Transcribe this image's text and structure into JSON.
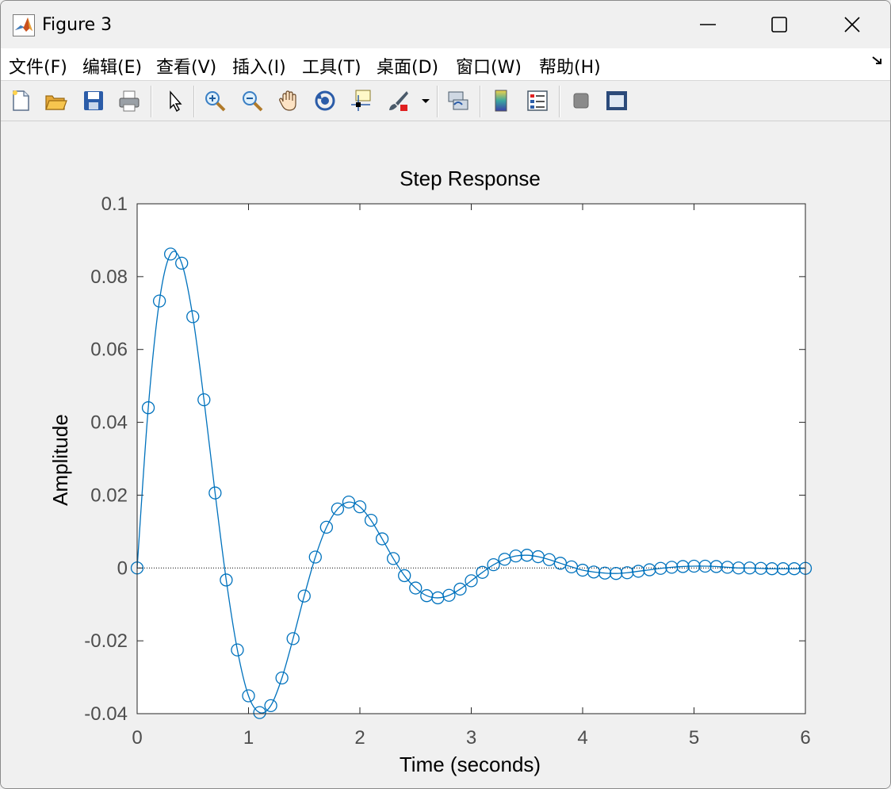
{
  "window": {
    "title": "Figure 3",
    "controls": [
      "minimize-icon",
      "maximize-icon",
      "close-icon"
    ]
  },
  "menu": {
    "items": [
      "文件(F)",
      "编辑(E)",
      "查看(V)",
      "插入(I)",
      "工具(T)",
      "桌面(D)",
      "窗口(W)",
      "帮助(H)"
    ]
  },
  "toolbar": {
    "icons": [
      "new-file-icon",
      "open-folder-icon",
      "save-icon",
      "print-icon",
      "pointer-icon",
      "zoom-in-icon",
      "zoom-out-icon",
      "pan-hand-icon",
      "rotate-3d-icon",
      "data-cursor-icon",
      "brush-icon",
      "brush-dropdown-icon",
      "link-plot-icon",
      "colorbar-icon",
      "legend-icon",
      "hide-plot-tools-icon",
      "show-plot-tools-icon"
    ]
  },
  "colors": {
    "line": "#0072bd",
    "axis": "#262626",
    "tick_text": "#4d4d4d"
  },
  "chart_data": {
    "type": "line",
    "title": "Step Response",
    "xlabel": "Time (seconds)",
    "ylabel": "Amplitude",
    "xlim": [
      0,
      6
    ],
    "ylim": [
      -0.04,
      0.1
    ],
    "xticks": [
      0,
      1,
      2,
      3,
      4,
      5,
      6
    ],
    "xtick_labels": [
      "0",
      "1",
      "2",
      "3",
      "4",
      "5",
      "6"
    ],
    "yticks": [
      -0.04,
      -0.02,
      0,
      0.02,
      0.04,
      0.06,
      0.08,
      0.1
    ],
    "ytick_labels": [
      "-0.04",
      "-0.02",
      "0",
      "0.02",
      "0.04",
      "0.06",
      "0.08",
      "0.1"
    ],
    "grid": false,
    "reference_line": 0,
    "series": [
      {
        "marker": "circle",
        "x": [
          0,
          0.1,
          0.2,
          0.3,
          0.4,
          0.5,
          0.6,
          0.7,
          0.8,
          0.9,
          1.0,
          1.1,
          1.2,
          1.3,
          1.4,
          1.5,
          1.6,
          1.7,
          1.8,
          1.9,
          2.0,
          2.1,
          2.2,
          2.3,
          2.4,
          2.5,
          2.6,
          2.7,
          2.8,
          2.9,
          3.0,
          3.1,
          3.2,
          3.3,
          3.4,
          3.5,
          3.6,
          3.7,
          3.8,
          3.9,
          4.0,
          4.1,
          4.2,
          4.3,
          4.4,
          4.5,
          4.6,
          4.7,
          4.8,
          4.9,
          5.0,
          5.1,
          5.2,
          5.3,
          5.4,
          5.5,
          5.6,
          5.7,
          5.8,
          5.9,
          6.0
        ],
        "y": [
          0,
          0.044,
          0.0733,
          0.0862,
          0.0837,
          0.069,
          0.0462,
          0.0206,
          -0.0033,
          -0.0225,
          -0.0351,
          -0.0397,
          -0.0378,
          -0.0302,
          -0.0194,
          -0.0077,
          0.003,
          0.0112,
          0.0162,
          0.0181,
          0.0168,
          0.0131,
          0.008,
          0.0026,
          -0.0021,
          -0.0055,
          -0.0076,
          -0.0082,
          -0.0075,
          -0.0058,
          -0.0035,
          -0.0012,
          0.0009,
          0.0024,
          0.0033,
          0.0035,
          0.0031,
          0.0023,
          0.0013,
          0.0003,
          -0.0006,
          -0.0011,
          -0.0014,
          -0.0015,
          -0.0013,
          -0.0009,
          -0.0005,
          -0.0001,
          0.0002,
          0.0004,
          0.0005,
          0.0005,
          0.0004,
          0.0002,
          0,
          0,
          -0.0001,
          -0.0002,
          -0.0002,
          -0.0002,
          -0.0001
        ]
      }
    ]
  }
}
